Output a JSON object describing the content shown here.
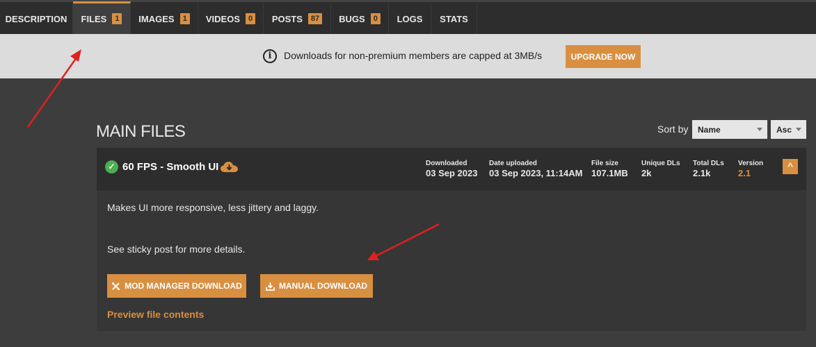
{
  "tabs": [
    {
      "label": "DESCRIPTION",
      "count": null
    },
    {
      "label": "FILES",
      "count": "1"
    },
    {
      "label": "IMAGES",
      "count": "1"
    },
    {
      "label": "VIDEOS",
      "count": "0"
    },
    {
      "label": "POSTS",
      "count": "87"
    },
    {
      "label": "BUGS",
      "count": "0"
    },
    {
      "label": "LOGS",
      "count": null
    },
    {
      "label": "STATS",
      "count": null
    }
  ],
  "banner": {
    "icon": "info-icon",
    "text": "Downloads for non-premium members are capped at 3MB/s",
    "upgrade_label": "UPGRADE NOW"
  },
  "main": {
    "title": "MAIN FILES",
    "sort_label": "Sort by",
    "sort_field": "Name",
    "sort_order": "Asc"
  },
  "file": {
    "name": "60 FPS - Smooth UI",
    "stats": {
      "downloaded_label": "Downloaded",
      "downloaded_value": "03 Sep 2023",
      "uploaded_label": "Date uploaded",
      "uploaded_value": "03 Sep 2023, 11:14AM",
      "size_label": "File size",
      "size_value": "107.1MB",
      "unique_label": "Unique DLs",
      "unique_value": "2k",
      "total_label": "Total DLs",
      "total_value": "2.1k",
      "version_label": "Version",
      "version_value": "2.1"
    },
    "description_line1": "Makes UI more responsive, less jittery and laggy.",
    "description_line2": "See sticky post for more details.",
    "mod_manager_label": "MOD MANAGER DOWNLOAD",
    "manual_label": "MANUAL DOWNLOAD",
    "preview_label": "Preview file contents"
  },
  "colors": {
    "accent": "#d98f40",
    "background": "#3d3d3d",
    "annotation_arrow": "#e02020"
  }
}
